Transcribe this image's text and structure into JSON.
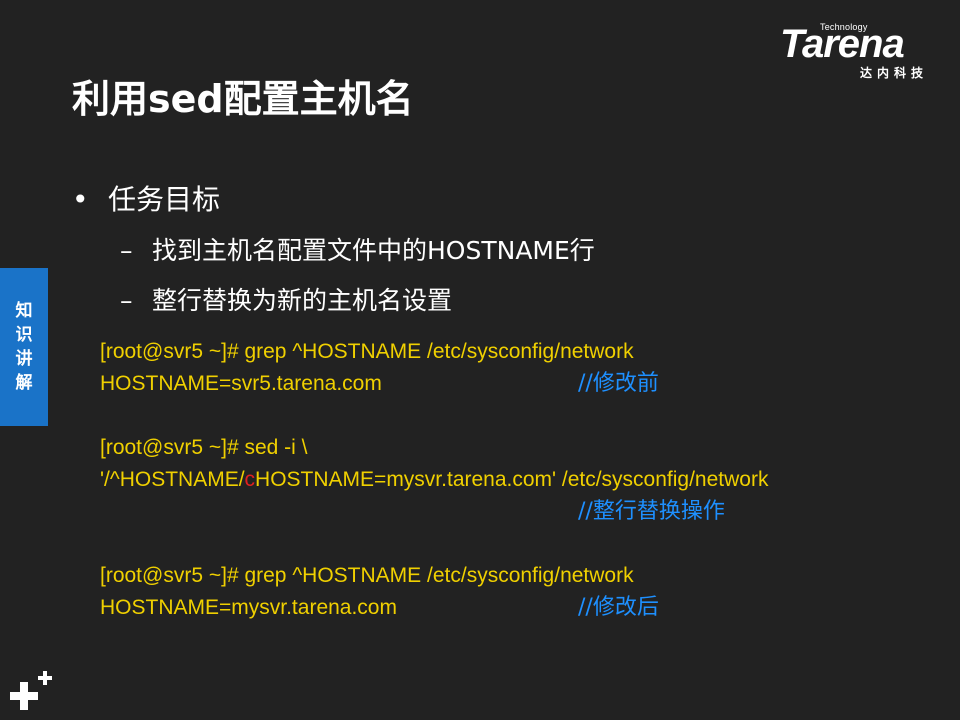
{
  "logo": {
    "technology": "Technology",
    "word": "Tarena",
    "cn": "达内科技"
  },
  "title": "利用sed配置主机名",
  "bullets": {
    "l1_marker": "•",
    "l1": "任务目标",
    "l2_marker": "–",
    "l2": [
      "找到主机名配置文件中的HOSTNAME行",
      "整行替换为新的主机名设置"
    ]
  },
  "side_tab": [
    "知",
    "识",
    "讲",
    "解"
  ],
  "code": {
    "line1": "[root@svr5 ~]# grep  ^HOSTNAME  /etc/sysconfig/network",
    "line2": "HOSTNAME=svr5.tarena.com",
    "line3": "[root@svr5 ~]# sed  -i  \\",
    "line4_pre": "'/^HOSTNAME/",
    "line4_red": "c",
    "line4_post": "HOSTNAME=mysvr.tarena.com' /etc/sysconfig/network",
    "line6": "[root@svr5 ~]# grep  ^HOSTNAME  /etc/sysconfig/network",
    "line7": "HOSTNAME=mysvr.tarena.com"
  },
  "comments": {
    "c1": "//修改前",
    "c2": "//整行替换操作",
    "c3": "//修改后"
  },
  "colors": {
    "background": "#222222",
    "code": "#f0d000",
    "comment": "#1e90ff",
    "highlight": "#e02020",
    "side_tab": "#1a73c8"
  },
  "icons": {
    "corner": "plus-icon"
  }
}
